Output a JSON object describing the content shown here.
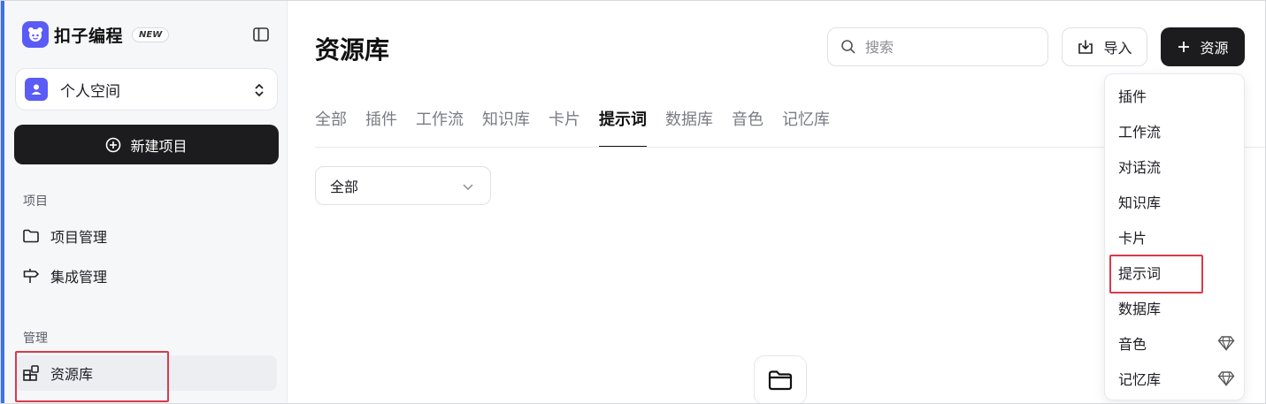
{
  "app": {
    "brand_name": "扣子编程",
    "brand_badge": "NEW"
  },
  "sidebar": {
    "workspace_label": "个人空间",
    "new_project_label": "新建项目",
    "section_project": "项目",
    "project_items": [
      {
        "label": "项目管理",
        "icon": "folder-icon"
      },
      {
        "label": "集成管理",
        "icon": "signpost-icon"
      }
    ],
    "section_manage": "管理",
    "manage_items": [
      {
        "label": "资源库",
        "icon": "library-icon",
        "active": true
      }
    ]
  },
  "main": {
    "title": "资源库",
    "search_placeholder": "搜索",
    "import_label": "导入",
    "resource_label": "资源",
    "tabs": [
      {
        "label": "全部",
        "active": false
      },
      {
        "label": "插件",
        "active": false
      },
      {
        "label": "工作流",
        "active": false
      },
      {
        "label": "知识库",
        "active": false
      },
      {
        "label": "卡片",
        "active": false
      },
      {
        "label": "提示词",
        "active": true
      },
      {
        "label": "数据库",
        "active": false
      },
      {
        "label": "音色",
        "active": false
      },
      {
        "label": "记忆库",
        "active": false
      }
    ],
    "filter_value": "全部"
  },
  "dropdown": {
    "items": [
      {
        "label": "插件",
        "premium": false
      },
      {
        "label": "工作流",
        "premium": false
      },
      {
        "label": "对话流",
        "premium": false
      },
      {
        "label": "知识库",
        "premium": false
      },
      {
        "label": "卡片",
        "premium": false
      },
      {
        "label": "提示词",
        "premium": false
      },
      {
        "label": "数据库",
        "premium": false
      },
      {
        "label": "音色",
        "premium": true
      },
      {
        "label": "记忆库",
        "premium": true
      }
    ]
  },
  "colors": {
    "accent_stripe": "#3d72e6",
    "brand": "#5b5bf6",
    "primary_button": "#1c1c1e",
    "highlight": "#d93a4a"
  }
}
